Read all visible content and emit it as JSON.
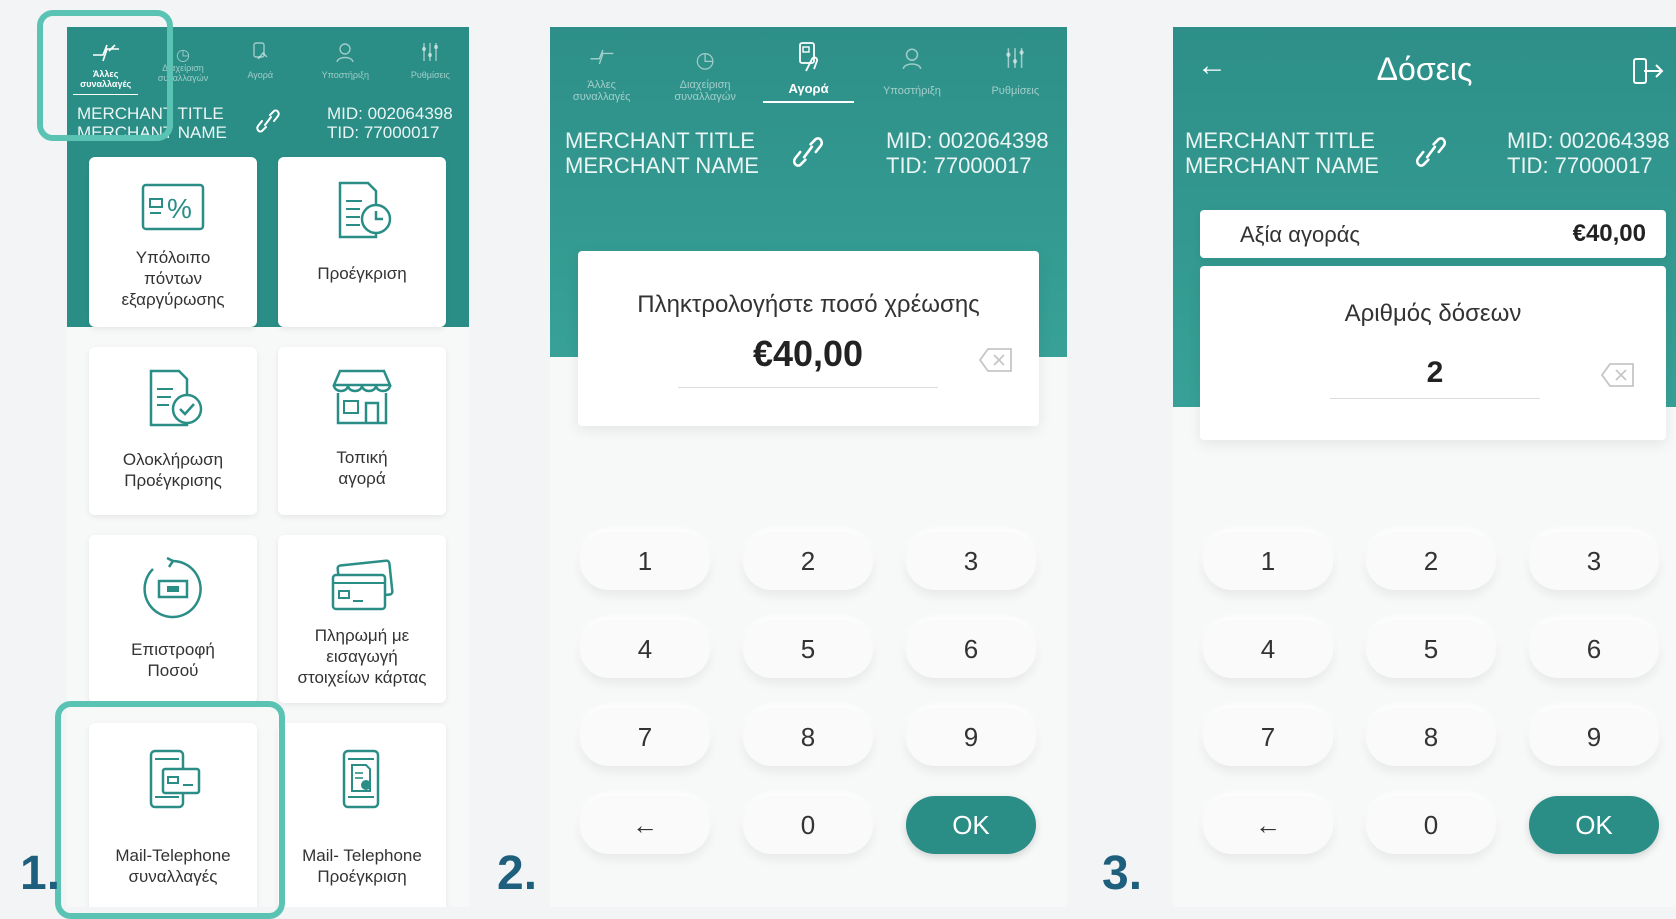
{
  "nav": [
    {
      "label_1": "Άλλες",
      "label_2": "συναλλαγές",
      "icon": "other-transactions-icon"
    },
    {
      "label_1": "Διαχείριση",
      "label_2": "συναλλαγών",
      "icon": "clock-icon"
    },
    {
      "label_1": "Αγορά",
      "label_2": "",
      "icon": "card-tap-icon"
    },
    {
      "label_1": "Υποστήριξη",
      "label_2": "",
      "icon": "support-agent-icon"
    },
    {
      "label_1": "Ρυθμίσεις",
      "label_2": "",
      "icon": "sliders-icon"
    }
  ],
  "merchant": {
    "title": "MERCHANT TITLE",
    "name": "MERCHANT NAME",
    "mid": "MID: 002064398",
    "tid": "TID: 77000017"
  },
  "tiles": [
    {
      "l1": "Υπόλοιπο",
      "l2": "πόντων",
      "l3": "εξαργύρωσης",
      "icon": "percent-card-icon"
    },
    {
      "l1": "Προέγκριση",
      "l2": "",
      "l3": "",
      "icon": "document-clock-icon"
    },
    {
      "l1": "Ολοκλήρωση",
      "l2": "Προέγκρισης",
      "l3": "",
      "icon": "document-check-icon"
    },
    {
      "l1": "Τοπική",
      "l2": "αγορά",
      "l3": "",
      "icon": "store-icon"
    },
    {
      "l1": "Επιστροφή",
      "l2": "Ποσού",
      "l3": "",
      "icon": "refund-icon"
    },
    {
      "l1": "Πληρωμή με",
      "l2": "εισαγωγή",
      "l3": "στοιχείων κάρτας",
      "icon": "cards-icon"
    },
    {
      "l1": "Mail-Telephone",
      "l2": "συναλλαγές",
      "l3": "",
      "icon": "phone-card-icon"
    },
    {
      "l1": "Mail- Telephone",
      "l2": "Προέγκριση",
      "l3": "",
      "icon": "phone-document-icon"
    }
  ],
  "screen2": {
    "prompt": "Πληκτρολογήστε ποσό χρέωσης",
    "amount": "€40,00"
  },
  "screen3": {
    "title": "Δόσεις",
    "purchase_label": "Αξία αγοράς",
    "purchase_value": "€40,00",
    "prompt": "Αριθμός δόσεων",
    "installments": "2"
  },
  "keypad": [
    "1",
    "2",
    "3",
    "4",
    "5",
    "6",
    "7",
    "8",
    "9",
    "←",
    "0",
    "OK"
  ],
  "steps": [
    "1.",
    "2.",
    "3."
  ],
  "colors": {
    "teal": "#2a8e87",
    "highlight": "#5bc3b4",
    "step": "#1f5f7e"
  }
}
